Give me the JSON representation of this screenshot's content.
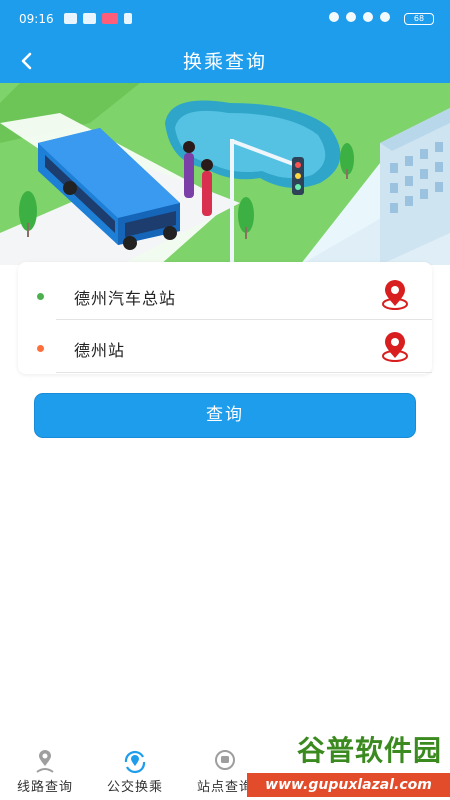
{
  "status_bar": {
    "time": "09:16",
    "battery": "68",
    "colors": {
      "background": "#1f9ded"
    }
  },
  "nav": {
    "title": "换乘查询",
    "back_icon": "chevron-left-icon"
  },
  "banner": {
    "illustration": "bus-station-illustration"
  },
  "route": {
    "start": {
      "value": "德州汽车总站",
      "dot_color": "#4caf50",
      "icon": "map-pin-icon"
    },
    "end": {
      "value": "德州站",
      "dot_color": "#ff6f3c",
      "icon": "map-pin-icon"
    }
  },
  "query_button": {
    "label": "查询",
    "color": "#1f9ded"
  },
  "tabs": [
    {
      "label": "线路查询",
      "icon": "route-pin-icon",
      "active": false
    },
    {
      "label": "公交换乘",
      "icon": "transfer-pin-icon",
      "active": true
    },
    {
      "label": "站点查询",
      "icon": "stop-pin-icon",
      "active": false
    }
  ],
  "watermark": {
    "title": "谷普软件园",
    "url": "www.gupuxlazal.com"
  }
}
